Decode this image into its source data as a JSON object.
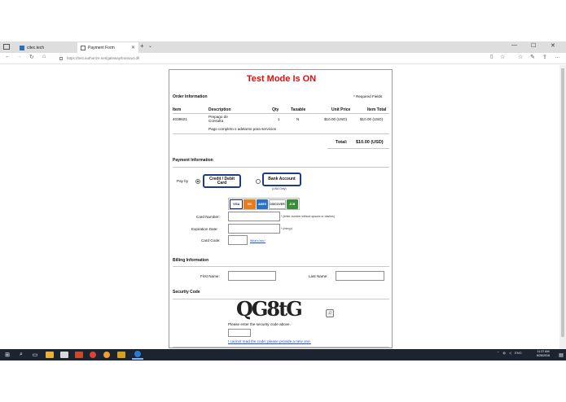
{
  "browser": {
    "tabs": [
      {
        "label": "citec.tech"
      },
      {
        "label": "Payment Form"
      }
    ],
    "url": "https://test.authorize.net/gateway/transact.dll"
  },
  "form": {
    "test_mode": "Test Mode Is ON",
    "order_section": "Order Information",
    "required_note": "* Required Fields",
    "columns": [
      "Item",
      "Description",
      "Qty",
      "Taxable",
      "Unit Price",
      "Item Total"
    ],
    "line_item": {
      "item": "4038621",
      "description": "Prepago de Consulta",
      "qty": "1",
      "taxable": "N",
      "unit_price": "$10.00 (USD)",
      "item_total": "$10.00 (USD)"
    },
    "item_note": "Pago completo o adelanto para servicios",
    "total_label": "Total:",
    "total_value": "$10.00 (USD)",
    "payment_section": "Payment Information",
    "pay_by_label": "Pay by",
    "credit_button": "Credit / Debit Card",
    "bank_button": "Bank Account",
    "usa_only": "(USA Only)",
    "cards": [
      "VISA",
      "MC",
      "AMEX",
      "DISCOVER",
      "JCB"
    ],
    "card_number_label": "Card Number:",
    "card_number_hint": "* (enter number without spaces or dashes)",
    "exp_label": "Expiration Date:",
    "exp_hint": "* (mmyy)",
    "code_label": "Card Code:",
    "whats_this": "What's this?",
    "billing_section": "Billing Information",
    "first_name_label": "First Name:",
    "last_name_label": "Last Name:",
    "security_section": "Security Code",
    "captcha_text": "QG8tG",
    "security_prompt": "Please enter the security code above.",
    "new_code_link": "I cannot read the code; please provide a new one."
  },
  "taskbar": {
    "lang": "ENG",
    "time": "11:37 AM",
    "date": "6/26/2018"
  },
  "colors": {
    "test_mode": "#e01010",
    "button_border": "#1b3c8a",
    "link": "#1a55cc",
    "taskbar": "#1d2431"
  }
}
